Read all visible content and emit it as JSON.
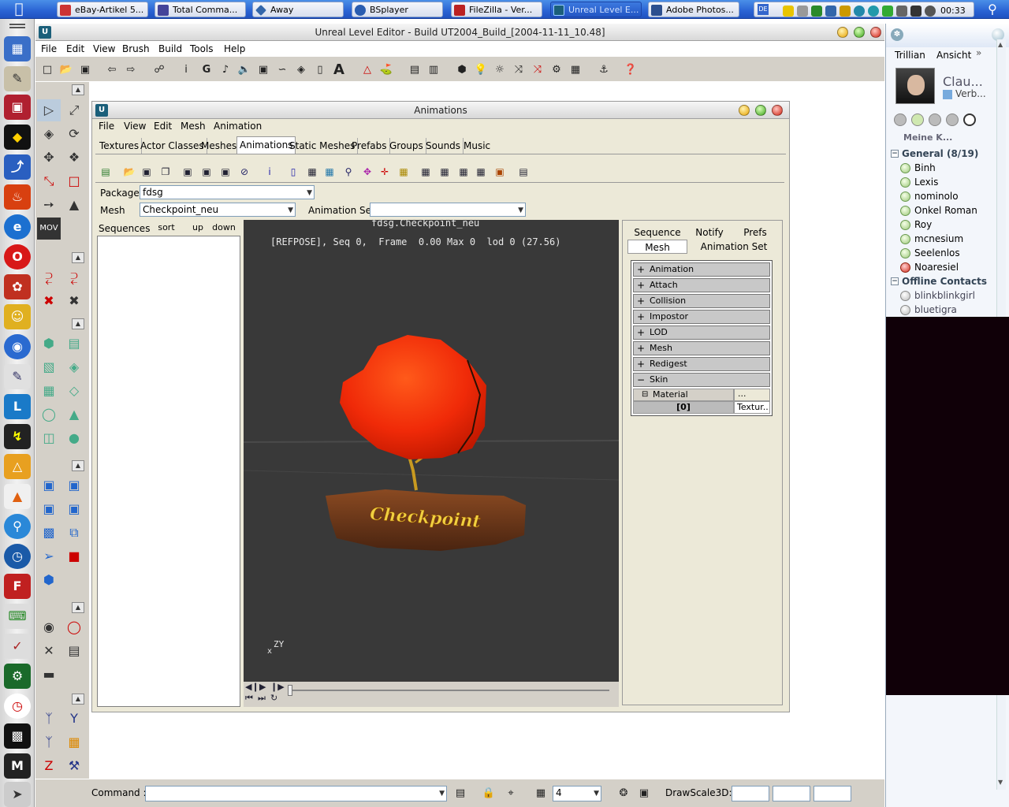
{
  "taskbar": {
    "tasks": [
      {
        "label": "eBay-Artikel 5..."
      },
      {
        "label": "Total Comma..."
      },
      {
        "label": "Away"
      },
      {
        "label": "BSplayer"
      },
      {
        "label": "FileZilla - Ver..."
      },
      {
        "label": "Unreal Level E..."
      },
      {
        "label": "Adobe Photos..."
      }
    ],
    "tray_lang": "DE",
    "clock": "00:33"
  },
  "main_window": {
    "title": "Unreal Level Editor - Build UT2004_Build_[2004-11-11_10.48]",
    "menu": [
      "File",
      "Edit",
      "View",
      "Brush",
      "Build",
      "Tools",
      "Help"
    ]
  },
  "command_bar": {
    "command_label": "Command :",
    "command_value": "",
    "grid_value": "4",
    "drawscale_label": "DrawScale3D:"
  },
  "animations_window": {
    "title": "Animations",
    "menu": [
      "File",
      "View",
      "Edit",
      "Mesh",
      "Animation"
    ],
    "tabs": [
      "Textures",
      "Actor Classes",
      "Meshes",
      "Animations",
      "Static Meshes",
      "Prefabs",
      "Groups",
      "Sounds",
      "Music"
    ],
    "selected_tab": "Animations",
    "package_label": "Package",
    "package_value": "fdsg",
    "mesh_label": "Mesh",
    "mesh_value": "Checkpoint_neu",
    "animset_label": "Animation Set",
    "animset_value": "",
    "sequences_label": "Sequences",
    "sort_label": "sort",
    "up_label": "up",
    "down_label": "down",
    "viewport": {
      "title": "fdsg.Checkpoint_neu",
      "status": "[REFPOSE], Seq 0,  Frame  0.00 Max 0  lod 0 (27.56)",
      "sign_text": "Checkpoint",
      "axes": "ZY",
      "axis_x": "x"
    },
    "prop_tabs": [
      "Sequence",
      "Notify",
      "Prefs",
      "Mesh",
      "Animation Set"
    ],
    "properties": [
      {
        "label": "Animation",
        "state": "+"
      },
      {
        "label": "Attach",
        "state": "+"
      },
      {
        "label": "Collision",
        "state": "+"
      },
      {
        "label": "Impostor",
        "state": "+"
      },
      {
        "label": "LOD",
        "state": "+"
      },
      {
        "label": "Mesh",
        "state": "+"
      },
      {
        "label": "Redigest",
        "state": "+"
      },
      {
        "label": "Skin",
        "state": "−"
      }
    ],
    "material_label": "Material",
    "material_btn": "...",
    "material_index": "[0]",
    "material_value": "Textur..."
  },
  "trillian": {
    "menu": [
      "Trillian",
      "Ansicht"
    ],
    "user_name": "Clau...",
    "user_status": "Verb...",
    "section": "Meine K...",
    "groups": [
      {
        "name": "General (8/19)",
        "contacts": [
          {
            "name": "Binh",
            "status": "online"
          },
          {
            "name": "Lexis",
            "status": "online"
          },
          {
            "name": "nominolo",
            "status": "online"
          },
          {
            "name": "Onkel Roman",
            "status": "online"
          },
          {
            "name": "Roy",
            "status": "online"
          },
          {
            "name": "mcnesium",
            "status": "online"
          },
          {
            "name": "Seelenlos",
            "status": "online"
          },
          {
            "name": "Noaresiel",
            "status": "blocked"
          }
        ]
      },
      {
        "name": "Offline Contacts",
        "contacts": [
          {
            "name": "blinkblinkgirl",
            "status": "offline"
          },
          {
            "name": "bluetigra",
            "status": "offline"
          }
        ]
      }
    ]
  }
}
